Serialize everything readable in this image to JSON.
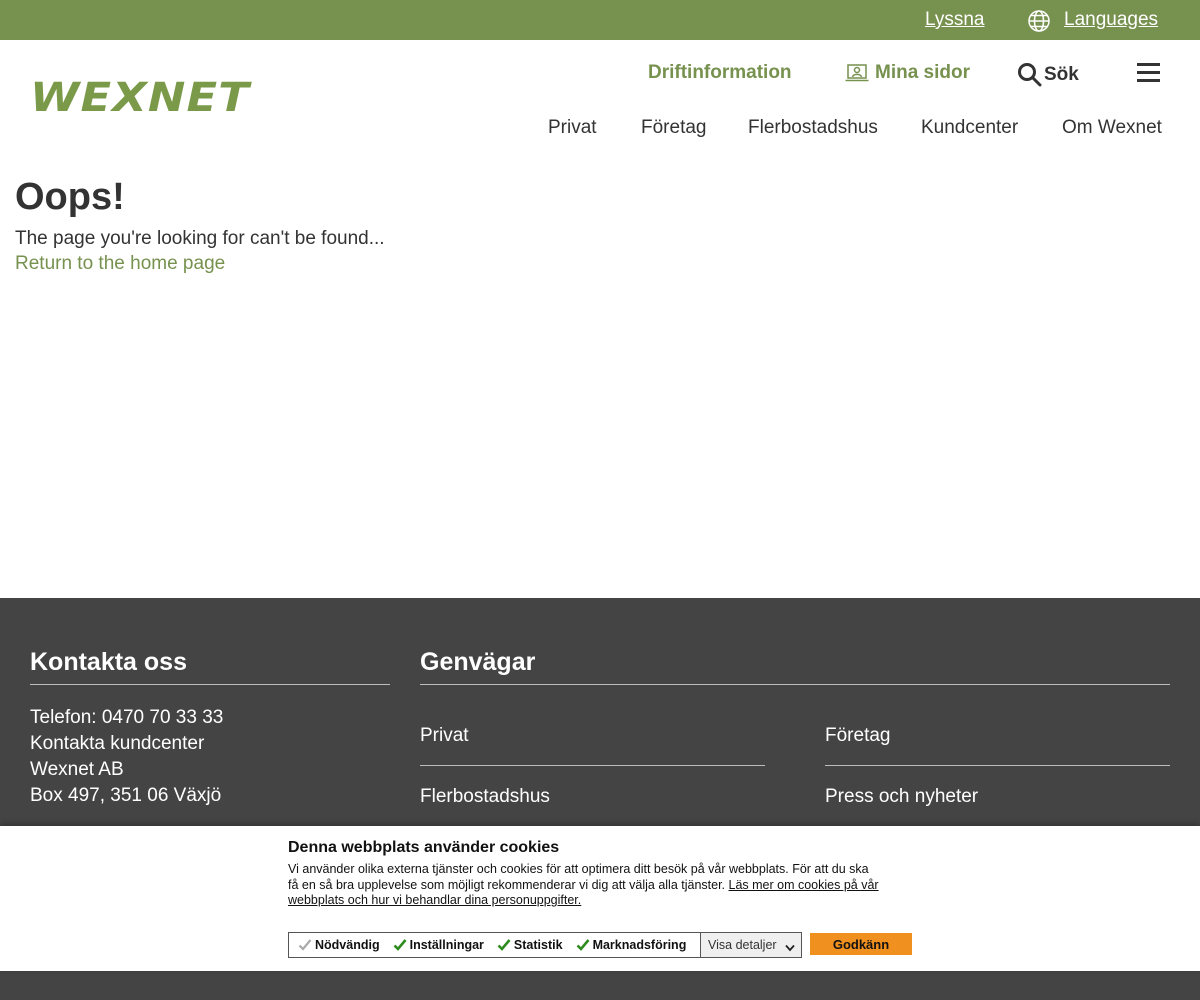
{
  "topbar": {
    "lyssna": "Lyssna",
    "languages": "Languages"
  },
  "header": {
    "logo_text": "WEXNET",
    "driftinformation": "Driftinformation",
    "mina_sidor": "Mina sidor",
    "sok": "Sök",
    "nav": [
      "Privat",
      "Företag",
      "Flerbostadshus",
      "Kundcenter",
      "Om Wexnet"
    ]
  },
  "main": {
    "heading": "Oops!",
    "message": "The page you're looking for can't be found...",
    "home_link": "Return to the home page"
  },
  "footer": {
    "contact_heading": "Kontakta oss",
    "contact_lines": [
      "Telefon: 0470 70 33 33",
      "Kontakta kundcenter",
      "Wexnet AB",
      "Box 497, 351 06 Växjö"
    ],
    "shortcuts_heading": "Genvägar",
    "shortcuts": [
      "Privat",
      "Företag",
      "Flerbostadshus",
      "Press och nyheter"
    ]
  },
  "cookie": {
    "title": "Denna webbplats använder cookies",
    "text_line1": "Vi använder olika externa tjänster och cookies för att optimera ditt besök på vår webbplats. För att du ska",
    "text_line2": "få en så bra upplevelse som möjligt rekommenderar vi dig att välja alla tjänster. ",
    "link_part1": "Läs mer om cookies på vår",
    "link_part2": "webbplats och hur vi behandlar dina personuppgifter.",
    "options": [
      "Nödvändig",
      "Inställningar",
      "Statistik",
      "Marknadsföring"
    ],
    "details_select": "Visa detaljer",
    "accept": "Godkänn"
  },
  "colors": {
    "brand_green": "#77914f",
    "footer_bg": "#444444",
    "accept_orange": "#f0901e",
    "check_green": "#2e8b1e"
  },
  "icons": [
    "globe-icon",
    "person-card-icon",
    "search-icon",
    "hamburger-menu-icon",
    "checkmark-icon",
    "chevron-down-icon"
  ]
}
